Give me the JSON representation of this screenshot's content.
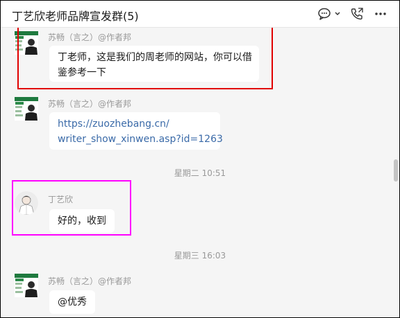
{
  "header": {
    "title": "丁艺欣老师品牌宣发群(5)"
  },
  "messages": [
    {
      "sender": "苏畅（言之）@作者邦",
      "text": "丁老师，这是我们的周老师的网站，你可以借鉴参考一下",
      "line1": "丁老师，这是我们的周老师的网站，你可以借",
      "line2": "鉴参考一下"
    },
    {
      "sender": "苏畅（言之）@作者邦",
      "line1": "https://zuozhebang.cn/",
      "line2": "writer_show_xinwen.asp?id=1263"
    },
    {
      "time": "星期二 10:51"
    },
    {
      "sender": "丁艺欣",
      "text": "好的，收到"
    },
    {
      "time": "星期三 16:03"
    },
    {
      "sender": "苏畅（言之）@作者邦",
      "text": "@优秀"
    }
  ],
  "colors": {
    "highlight_red": "#e10000",
    "highlight_magenta": "#ff00ff",
    "link": "#3a6aa8"
  }
}
